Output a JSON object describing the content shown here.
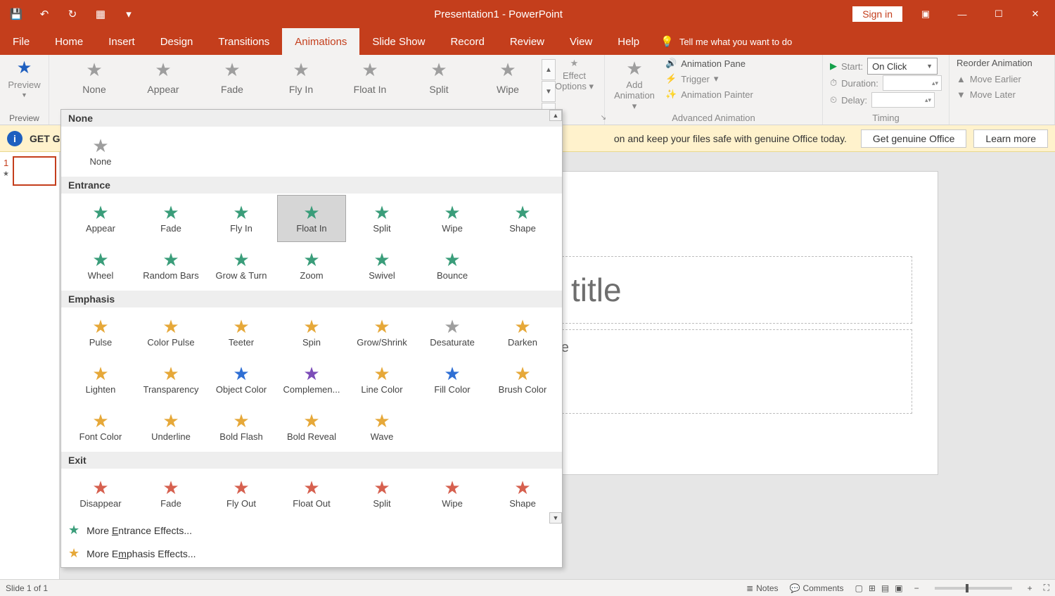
{
  "title": "Presentation1 - PowerPoint",
  "signin": "Sign in",
  "tabs": [
    "File",
    "Home",
    "Insert",
    "Design",
    "Transitions",
    "Animations",
    "Slide Show",
    "Record",
    "Review",
    "View",
    "Help"
  ],
  "active_tab": "Animations",
  "tellme": "Tell me what you want to do",
  "preview_label": "Preview",
  "ribbon_gallery": [
    "None",
    "Appear",
    "Fade",
    "Fly In",
    "Float In",
    "Split",
    "Wipe"
  ],
  "effect_options": "Effect Options",
  "add_animation": "Add Animation",
  "adv": {
    "pane": "Animation Pane",
    "trigger": "Trigger",
    "painter": "Animation Painter",
    "label": "Advanced Animation"
  },
  "timing": {
    "start": "Start:",
    "start_value": "On Click",
    "duration": "Duration:",
    "delay": "Delay:",
    "label": "Timing"
  },
  "reorder": {
    "hdr": "Reorder Animation",
    "earlier": "Move Earlier",
    "later": "Move Later"
  },
  "yellow": {
    "get": "GET G",
    "msg": "on and keep your files safe with genuine Office today.",
    "btn1": "Get genuine Office",
    "btn2": "Learn more"
  },
  "slide": {
    "title_ph": "k to add title",
    "sub_ph": "Click to add subtitle",
    "num": "1"
  },
  "status": {
    "left": "Slide 1 of 1",
    "notes": "Notes",
    "comments": "Comments"
  },
  "gallery": {
    "groups": [
      {
        "name": "None",
        "items": [
          {
            "label": "None",
            "color": "c-gray"
          }
        ]
      },
      {
        "name": "Entrance",
        "items": [
          {
            "label": "Appear",
            "color": "c-green"
          },
          {
            "label": "Fade",
            "color": "c-green"
          },
          {
            "label": "Fly In",
            "color": "c-green"
          },
          {
            "label": "Float In",
            "color": "c-green",
            "selected": true
          },
          {
            "label": "Split",
            "color": "c-green"
          },
          {
            "label": "Wipe",
            "color": "c-green"
          },
          {
            "label": "Shape",
            "color": "c-green"
          },
          {
            "label": "Wheel",
            "color": "c-green"
          },
          {
            "label": "Random Bars",
            "color": "c-green"
          },
          {
            "label": "Grow & Turn",
            "color": "c-green"
          },
          {
            "label": "Zoom",
            "color": "c-green"
          },
          {
            "label": "Swivel",
            "color": "c-green"
          },
          {
            "label": "Bounce",
            "color": "c-green"
          }
        ]
      },
      {
        "name": "Emphasis",
        "items": [
          {
            "label": "Pulse",
            "color": "c-yellow"
          },
          {
            "label": "Color Pulse",
            "color": "c-yellow"
          },
          {
            "label": "Teeter",
            "color": "c-yellow"
          },
          {
            "label": "Spin",
            "color": "c-yellow"
          },
          {
            "label": "Grow/Shrink",
            "color": "c-yellow"
          },
          {
            "label": "Desaturate",
            "color": "c-gray"
          },
          {
            "label": "Darken",
            "color": "c-yellow"
          },
          {
            "label": "Lighten",
            "color": "c-yellow"
          },
          {
            "label": "Transparency",
            "color": "c-yellow"
          },
          {
            "label": "Object Color",
            "color": "c-blue"
          },
          {
            "label": "Complemen...",
            "color": "c-purple"
          },
          {
            "label": "Line Color",
            "color": "c-yellow"
          },
          {
            "label": "Fill Color",
            "color": "c-blue"
          },
          {
            "label": "Brush Color",
            "color": "c-yellow"
          },
          {
            "label": "Font Color",
            "color": "c-yellow"
          },
          {
            "label": "Underline",
            "color": "c-yellow"
          },
          {
            "label": "Bold Flash",
            "color": "c-yellow"
          },
          {
            "label": "Bold Reveal",
            "color": "c-yellow"
          },
          {
            "label": "Wave",
            "color": "c-yellow"
          }
        ]
      },
      {
        "name": "Exit",
        "items": [
          {
            "label": "Disappear",
            "color": "c-red"
          },
          {
            "label": "Fade",
            "color": "c-red"
          },
          {
            "label": "Fly Out",
            "color": "c-red"
          },
          {
            "label": "Float Out",
            "color": "c-red"
          },
          {
            "label": "Split",
            "color": "c-red"
          },
          {
            "label": "Wipe",
            "color": "c-red"
          },
          {
            "label": "Shape",
            "color": "c-red"
          }
        ]
      }
    ],
    "more_entrance": "More Entrance Effects...",
    "more_emphasis": "More Emphasis Effects...",
    "more_entrance_u": "E",
    "more_emphasis_u": "m"
  }
}
